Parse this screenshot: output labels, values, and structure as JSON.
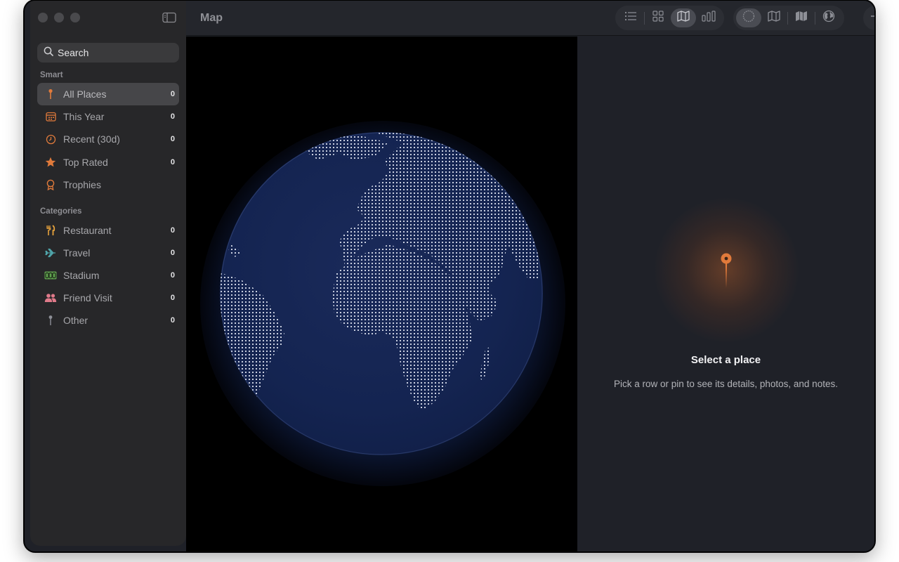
{
  "window": {
    "title": "Map"
  },
  "search": {
    "placeholder": "Search"
  },
  "sidebar": {
    "smart_title": "Smart",
    "smart": [
      {
        "label": "All Places",
        "count": "0",
        "icon": "pin-icon",
        "color": "#e07a3b",
        "active": true
      },
      {
        "label": "This Year",
        "count": "0",
        "icon": "calendar-icon",
        "color": "#e07a3b"
      },
      {
        "label": "Recent (30d)",
        "count": "0",
        "icon": "clock-icon",
        "color": "#e07a3b"
      },
      {
        "label": "Top Rated",
        "count": "0",
        "icon": "star-icon",
        "color": "#e07a3b"
      },
      {
        "label": "Trophies",
        "count": "",
        "icon": "trophy-icon",
        "color": "#e07a3b"
      }
    ],
    "categories_title": "Categories",
    "categories": [
      {
        "label": "Restaurant",
        "count": "0",
        "icon": "fork-knife-icon",
        "color": "#e6a23c"
      },
      {
        "label": "Travel",
        "count": "0",
        "icon": "airplane-icon",
        "color": "#4fa3a8"
      },
      {
        "label": "Stadium",
        "count": "0",
        "icon": "scoreboard-icon",
        "color": "#5fa04e"
      },
      {
        "label": "Friend Visit",
        "count": "0",
        "icon": "people-icon",
        "color": "#e07a8a"
      },
      {
        "label": "Other",
        "count": "0",
        "icon": "pin-icon",
        "color": "#8d8f97"
      }
    ]
  },
  "toolbar": {
    "view_buttons": [
      "list-icon",
      "grid-icon",
      "map-icon",
      "chart-icon"
    ],
    "selected_view": "map-icon",
    "style_buttons": [
      "globe-outline-icon",
      "map-outline-icon",
      "map-filled-icon",
      "globe-icon"
    ],
    "selected_style": "globe-outline-icon",
    "add_icon": "plus-icon"
  },
  "detail": {
    "title": "Select a place",
    "subtitle": "Pick a row or pin to see its details, photos, and notes.",
    "accent": "#e07a3b"
  }
}
